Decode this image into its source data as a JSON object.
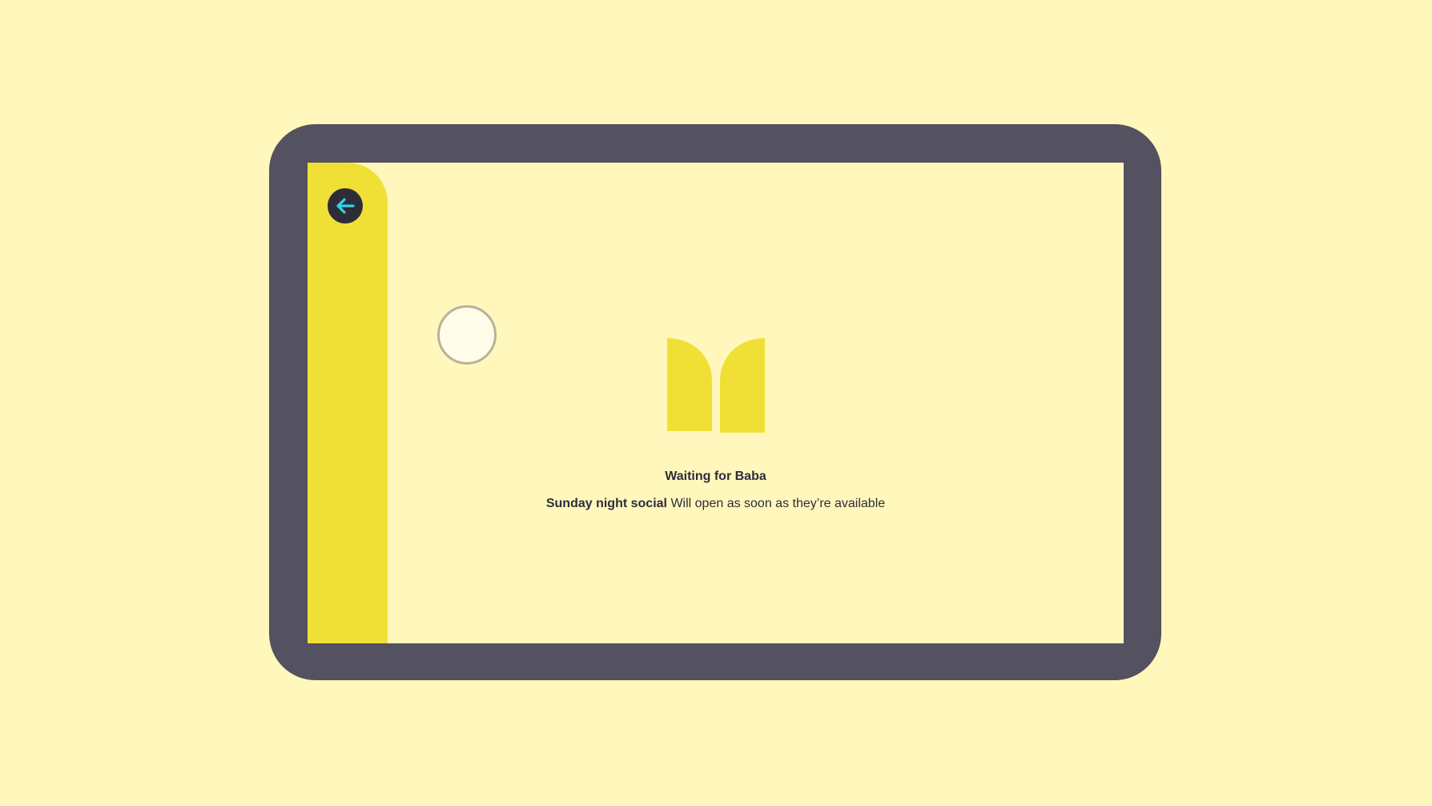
{
  "colors": {
    "page_background": "#fff7bc",
    "device_frame": "#545160",
    "sidebar": "#f0e036",
    "back_button": "#2f2c3a",
    "back_arrow": "#2ed6e6",
    "text": "#2f2c3a",
    "logo": "#f0e036"
  },
  "icons": {
    "back": "arrow-left-icon",
    "logo": "twin-arch-logo-icon"
  },
  "waiting": {
    "title": "Waiting for Baba",
    "event_name": "Sunday night social",
    "message": "Will open as soon as they’re available"
  }
}
